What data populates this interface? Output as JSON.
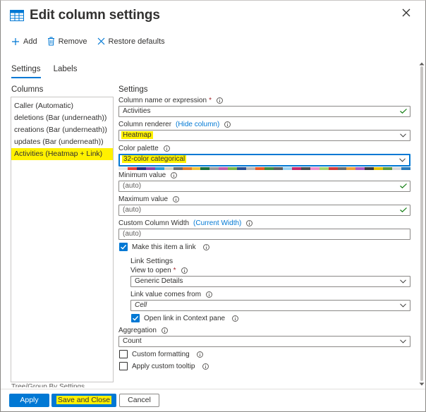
{
  "dialog": {
    "title": "Edit column settings",
    "icon": "table-grid-icon",
    "close_icon": "close-icon"
  },
  "toolbar": {
    "add_label": "Add",
    "remove_label": "Remove",
    "restore_label": "Restore defaults"
  },
  "tabs": [
    {
      "label": "Settings",
      "active": true
    },
    {
      "label": "Labels",
      "active": false
    }
  ],
  "columns": {
    "title": "Columns",
    "items": [
      {
        "label": "Caller (Automatic)",
        "selected": false
      },
      {
        "label": "deletions (Bar (underneath))",
        "selected": false
      },
      {
        "label": "creations (Bar (underneath))",
        "selected": false
      },
      {
        "label": "updates (Bar (underneath))",
        "selected": false
      },
      {
        "label": "Activities (Heatmap + Link)",
        "selected": true
      }
    ]
  },
  "settings": {
    "title": "Settings",
    "column_name": {
      "label": "Column name or expression",
      "required": "*",
      "value": "Activities"
    },
    "renderer": {
      "label": "Column renderer",
      "link": "(Hide column)",
      "value": "Heatmap"
    },
    "palette": {
      "label": "Color palette",
      "value": "32-color categorical",
      "colors": [
        "#e8e8e8",
        "#e8403a",
        "#252c7d",
        "#8e44ad",
        "#2e9cd3",
        "#d6d3c4",
        "#6d6d6d",
        "#e27c2d",
        "#f2c23b",
        "#1b6f3b",
        "#9b9b9b",
        "#c45ba8",
        "#7ab648",
        "#2a4e8f",
        "#b8b8b8",
        "#ee5a24",
        "#3f8e3f",
        "#5e5e5e",
        "#9bd2f0",
        "#c9286b",
        "#4d4d4d",
        "#ef8fcb",
        "#a7d56c",
        "#d23a3a",
        "#6b6b6b",
        "#f0a23b",
        "#b05cc1",
        "#3a3a3a",
        "#e6c200",
        "#5d9b3d",
        "#d8d8d8",
        "#2b7bb9"
      ]
    },
    "min_value": {
      "label": "Minimum value",
      "placeholder": "(auto)"
    },
    "max_value": {
      "label": "Maximum value",
      "placeholder": "(auto)"
    },
    "custom_width": {
      "label": "Custom Column Width",
      "link": "(Current Width)",
      "placeholder": "(auto)"
    },
    "make_link": {
      "label": "Make this item a link",
      "checked": true
    },
    "link_settings": {
      "title": "Link Settings",
      "view_to_open": {
        "label": "View to open",
        "required": "*",
        "value": "Generic Details"
      },
      "link_value_from": {
        "label": "Link value comes from",
        "value": "Cell"
      },
      "open_in_context": {
        "label": "Open link in Context pane",
        "checked": true
      }
    },
    "aggregation": {
      "label": "Aggregation",
      "value": "Count"
    },
    "custom_formatting": {
      "label": "Custom formatting",
      "checked": false
    },
    "custom_tooltip": {
      "label": "Apply custom tooltip",
      "checked": false
    }
  },
  "clipped_section_label": "Tree/Group By Settings",
  "footer": {
    "apply_label": "Apply",
    "save_close_label": "Save and Close",
    "cancel_label": "Cancel"
  },
  "colors": {
    "accent": "#0078d4",
    "highlight": "#fff100",
    "valid_check": "#107c10"
  }
}
